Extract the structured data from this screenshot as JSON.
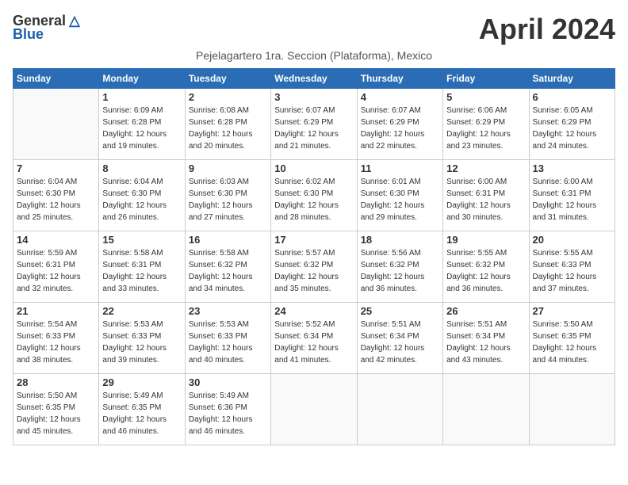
{
  "logo": {
    "general": "General",
    "blue": "Blue",
    "tagline": ""
  },
  "header": {
    "month_title": "April 2024",
    "subtitle": "Pejelagartero 1ra. Seccion (Plataforma), Mexico"
  },
  "weekdays": [
    "Sunday",
    "Monday",
    "Tuesday",
    "Wednesday",
    "Thursday",
    "Friday",
    "Saturday"
  ],
  "weeks": [
    [
      {
        "day": "",
        "info": ""
      },
      {
        "day": "1",
        "info": "Sunrise: 6:09 AM\nSunset: 6:28 PM\nDaylight: 12 hours\nand 19 minutes."
      },
      {
        "day": "2",
        "info": "Sunrise: 6:08 AM\nSunset: 6:28 PM\nDaylight: 12 hours\nand 20 minutes."
      },
      {
        "day": "3",
        "info": "Sunrise: 6:07 AM\nSunset: 6:29 PM\nDaylight: 12 hours\nand 21 minutes."
      },
      {
        "day": "4",
        "info": "Sunrise: 6:07 AM\nSunset: 6:29 PM\nDaylight: 12 hours\nand 22 minutes."
      },
      {
        "day": "5",
        "info": "Sunrise: 6:06 AM\nSunset: 6:29 PM\nDaylight: 12 hours\nand 23 minutes."
      },
      {
        "day": "6",
        "info": "Sunrise: 6:05 AM\nSunset: 6:29 PM\nDaylight: 12 hours\nand 24 minutes."
      }
    ],
    [
      {
        "day": "7",
        "info": "Sunrise: 6:04 AM\nSunset: 6:30 PM\nDaylight: 12 hours\nand 25 minutes."
      },
      {
        "day": "8",
        "info": "Sunrise: 6:04 AM\nSunset: 6:30 PM\nDaylight: 12 hours\nand 26 minutes."
      },
      {
        "day": "9",
        "info": "Sunrise: 6:03 AM\nSunset: 6:30 PM\nDaylight: 12 hours\nand 27 minutes."
      },
      {
        "day": "10",
        "info": "Sunrise: 6:02 AM\nSunset: 6:30 PM\nDaylight: 12 hours\nand 28 minutes."
      },
      {
        "day": "11",
        "info": "Sunrise: 6:01 AM\nSunset: 6:30 PM\nDaylight: 12 hours\nand 29 minutes."
      },
      {
        "day": "12",
        "info": "Sunrise: 6:00 AM\nSunset: 6:31 PM\nDaylight: 12 hours\nand 30 minutes."
      },
      {
        "day": "13",
        "info": "Sunrise: 6:00 AM\nSunset: 6:31 PM\nDaylight: 12 hours\nand 31 minutes."
      }
    ],
    [
      {
        "day": "14",
        "info": "Sunrise: 5:59 AM\nSunset: 6:31 PM\nDaylight: 12 hours\nand 32 minutes."
      },
      {
        "day": "15",
        "info": "Sunrise: 5:58 AM\nSunset: 6:31 PM\nDaylight: 12 hours\nand 33 minutes."
      },
      {
        "day": "16",
        "info": "Sunrise: 5:58 AM\nSunset: 6:32 PM\nDaylight: 12 hours\nand 34 minutes."
      },
      {
        "day": "17",
        "info": "Sunrise: 5:57 AM\nSunset: 6:32 PM\nDaylight: 12 hours\nand 35 minutes."
      },
      {
        "day": "18",
        "info": "Sunrise: 5:56 AM\nSunset: 6:32 PM\nDaylight: 12 hours\nand 36 minutes."
      },
      {
        "day": "19",
        "info": "Sunrise: 5:55 AM\nSunset: 6:32 PM\nDaylight: 12 hours\nand 36 minutes."
      },
      {
        "day": "20",
        "info": "Sunrise: 5:55 AM\nSunset: 6:33 PM\nDaylight: 12 hours\nand 37 minutes."
      }
    ],
    [
      {
        "day": "21",
        "info": "Sunrise: 5:54 AM\nSunset: 6:33 PM\nDaylight: 12 hours\nand 38 minutes."
      },
      {
        "day": "22",
        "info": "Sunrise: 5:53 AM\nSunset: 6:33 PM\nDaylight: 12 hours\nand 39 minutes."
      },
      {
        "day": "23",
        "info": "Sunrise: 5:53 AM\nSunset: 6:33 PM\nDaylight: 12 hours\nand 40 minutes."
      },
      {
        "day": "24",
        "info": "Sunrise: 5:52 AM\nSunset: 6:34 PM\nDaylight: 12 hours\nand 41 minutes."
      },
      {
        "day": "25",
        "info": "Sunrise: 5:51 AM\nSunset: 6:34 PM\nDaylight: 12 hours\nand 42 minutes."
      },
      {
        "day": "26",
        "info": "Sunrise: 5:51 AM\nSunset: 6:34 PM\nDaylight: 12 hours\nand 43 minutes."
      },
      {
        "day": "27",
        "info": "Sunrise: 5:50 AM\nSunset: 6:35 PM\nDaylight: 12 hours\nand 44 minutes."
      }
    ],
    [
      {
        "day": "28",
        "info": "Sunrise: 5:50 AM\nSunset: 6:35 PM\nDaylight: 12 hours\nand 45 minutes."
      },
      {
        "day": "29",
        "info": "Sunrise: 5:49 AM\nSunset: 6:35 PM\nDaylight: 12 hours\nand 46 minutes."
      },
      {
        "day": "30",
        "info": "Sunrise: 5:49 AM\nSunset: 6:36 PM\nDaylight: 12 hours\nand 46 minutes."
      },
      {
        "day": "",
        "info": ""
      },
      {
        "day": "",
        "info": ""
      },
      {
        "day": "",
        "info": ""
      },
      {
        "day": "",
        "info": ""
      }
    ]
  ]
}
